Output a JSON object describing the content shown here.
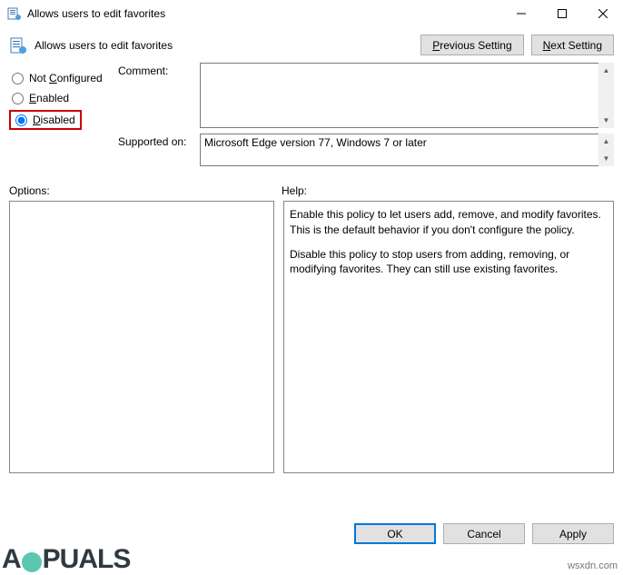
{
  "window": {
    "title": "Allows users to edit favorites"
  },
  "header": {
    "title": "Allows users to edit favorites",
    "prev_btn": "Previous Setting",
    "next_btn": "Next Setting"
  },
  "radios": {
    "not_configured": "Not Configured",
    "enabled": "Enabled",
    "disabled": "Disabled",
    "selected": "disabled"
  },
  "fields": {
    "comment_label": "Comment:",
    "comment_value": "",
    "supported_label": "Supported on:",
    "supported_value": "Microsoft Edge version 77, Windows 7 or later"
  },
  "lower": {
    "options_label": "Options:",
    "help_label": "Help:",
    "help_p1": "Enable this policy to let users add, remove, and modify favorites. This is the default behavior if you don't configure the policy.",
    "help_p2": "Disable this policy to stop users from adding, removing, or modifying favorites. They can still use existing favorites."
  },
  "footer": {
    "ok": "OK",
    "cancel": "Cancel",
    "apply": "Apply"
  },
  "watermark": {
    "right": "wsxdn.com"
  }
}
